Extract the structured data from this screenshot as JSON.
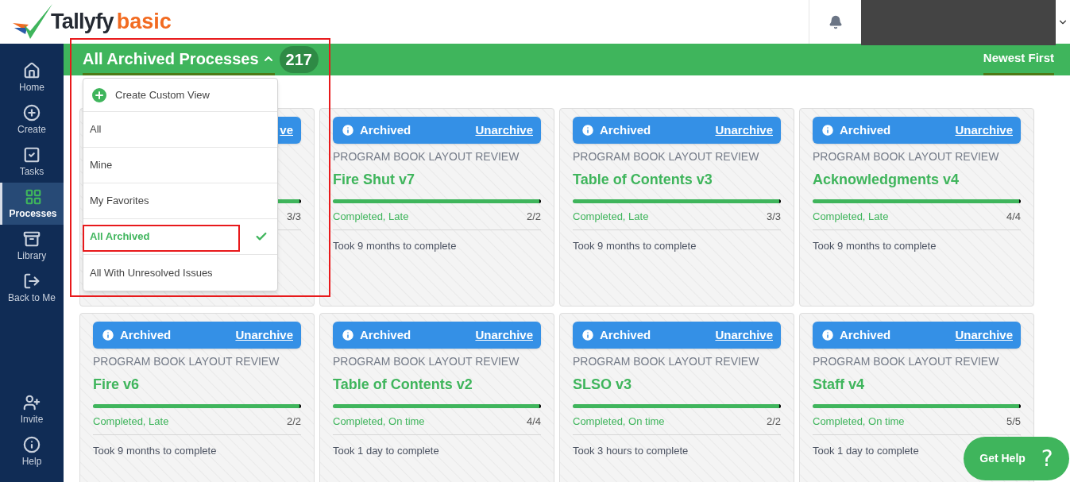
{
  "header": {
    "brand": "Tallyfy",
    "edition": "basic"
  },
  "sidebar": {
    "items": [
      {
        "label": "Home",
        "selected": false
      },
      {
        "label": "Create",
        "selected": false
      },
      {
        "label": "Tasks",
        "selected": false
      },
      {
        "label": "Processes",
        "selected": true
      },
      {
        "label": "Library",
        "selected": false
      },
      {
        "label": "Back to Me",
        "selected": false
      }
    ],
    "bottom_items": [
      {
        "label": "Invite"
      },
      {
        "label": "Help"
      }
    ]
  },
  "toolbar": {
    "title": "All Archived Processes",
    "count": "217",
    "expanded": true,
    "annotated": true,
    "sort": "Newest First"
  },
  "dropdown": {
    "create_label": "Create Custom View",
    "items": [
      {
        "label": "All",
        "selected": false,
        "annotated": false
      },
      {
        "label": "Mine",
        "selected": false,
        "annotated": false
      },
      {
        "label": "My Favorites",
        "selected": false,
        "annotated": false
      },
      {
        "label": "All Archived",
        "selected": true,
        "annotated": true
      },
      {
        "label": "All With Unresolved Issues",
        "selected": false,
        "annotated": false
      }
    ]
  },
  "cards": [
    {
      "action": "ve",
      "count": "3/3",
      "level": 1
    },
    {
      "status": "Archived",
      "action": "Unarchive",
      "template": "PROGRAM BOOK LAYOUT REVIEW",
      "title": "Fire Shut v7",
      "level": 1,
      "state": "Completed, Late",
      "count": "2/2",
      "duration": "Took 9 months to complete"
    },
    {
      "status": "Archived",
      "action": "Unarchive",
      "template": "PROGRAM BOOK LAYOUT REVIEW",
      "title": "Table of Contents v3",
      "level": 1,
      "state": "Completed, Late",
      "count": "3/3",
      "duration": "Took 9 months to complete"
    },
    {
      "status": "Archived",
      "action": "Unarchive",
      "template": "PROGRAM BOOK LAYOUT REVIEW",
      "title": "Acknowledgments v4",
      "level": 1,
      "state": "Completed, Late",
      "count": "4/4",
      "duration": "Took 9 months to complete"
    },
    {
      "status": "Archived",
      "action": "Unarchive",
      "template": "PROGRAM BOOK LAYOUT REVIEW",
      "title": "Fire v6",
      "level": 1,
      "state": "Completed, Late",
      "count": "2/2",
      "duration": "Took 9 months to complete"
    },
    {
      "status": "Archived",
      "action": "Unarchive",
      "template": "PROGRAM BOOK LAYOUT REVIEW",
      "title": "Table of Contents v2",
      "level": 1,
      "state": "Completed, On time",
      "count": "4/4",
      "duration": "Took 1 day to complete"
    },
    {
      "status": "Archived",
      "action": "Unarchive",
      "template": "PROGRAM BOOK LAYOUT REVIEW",
      "title": "SLSO v3",
      "level": 1,
      "state": "Completed, On time",
      "count": "2/2",
      "duration": "Took 3 hours to complete"
    },
    {
      "status": "Archived",
      "action": "Unarchive",
      "template": "PROGRAM BOOK LAYOUT REVIEW",
      "title": "Staff v4",
      "level": 1,
      "state": "Completed, On time",
      "count": "5/5",
      "duration": "Took 1 day to complete"
    }
  ],
  "help_button": {
    "label": "Get Help",
    "icon_text": "?"
  }
}
